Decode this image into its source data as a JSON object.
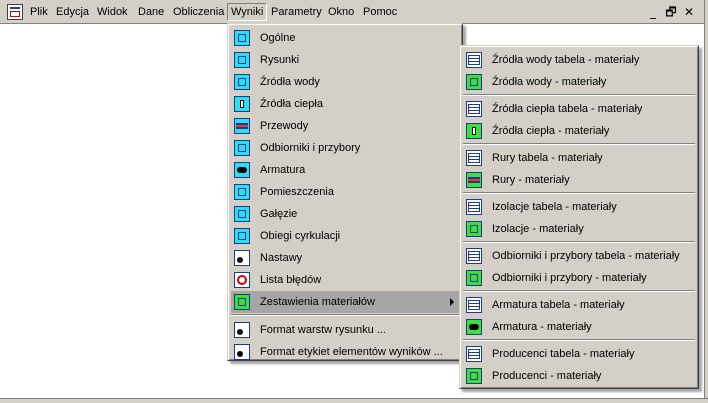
{
  "menubar": {
    "items": [
      "Plik",
      "Edycja",
      "Widok",
      "Dane",
      "Obliczenia",
      "Wyniki",
      "Parametry",
      "Okno",
      "Pomoc"
    ],
    "active": "Wyniki",
    "controls": [
      "_",
      "🗗",
      "✕"
    ]
  },
  "wyniki_menu": {
    "items": [
      {
        "label": "Ogólne",
        "icon": "house-icon"
      },
      {
        "label": "Rysunki",
        "icon": "drawing-icon"
      },
      {
        "label": "Źródła wody",
        "icon": "water-source-icon"
      },
      {
        "label": "Źródła ciepła",
        "icon": "heat-source-icon"
      },
      {
        "label": "Przewody",
        "icon": "pipes-icon"
      },
      {
        "label": "Odbiorniki i przybory",
        "icon": "receivers-icon"
      },
      {
        "label": "Armatura",
        "icon": "fittings-icon"
      },
      {
        "label": "Pomieszczenia",
        "icon": "rooms-icon"
      },
      {
        "label": "Gałęzie",
        "icon": "branches-icon"
      },
      {
        "label": "Obiegi cyrkulacji",
        "icon": "circulation-icon"
      },
      {
        "label": "Nastawy",
        "icon": "settings-icon"
      },
      {
        "label": "Lista błędów",
        "icon": "error-list-icon"
      },
      {
        "label": "Zestawienia materiałów",
        "icon": "materials-icon"
      },
      {
        "label": "Format warstw rysunku ...",
        "icon": "layers-format-icon"
      },
      {
        "label": "Format etykiet elementów wyników ...",
        "icon": "labels-format-icon"
      }
    ],
    "highlighted": "Zestawienia materiałów"
  },
  "materials_submenu": {
    "items": [
      {
        "label": "Źródła wody tabela - materiały",
        "icon": "water-source-table-icon"
      },
      {
        "label": "Źródła wody - materiały",
        "icon": "water-source-icon"
      },
      {
        "label": "Źródła ciepła tabela - materiały",
        "icon": "heat-source-table-icon"
      },
      {
        "label": "Źródła ciepła - materiały",
        "icon": "heat-source-icon"
      },
      {
        "label": "Rury tabela - materiały",
        "icon": "pipes-table-icon"
      },
      {
        "label": "Rury - materiały",
        "icon": "pipes-icon"
      },
      {
        "label": "Izolacje tabela - materiały",
        "icon": "insulation-table-icon"
      },
      {
        "label": "Izolacje - materiały",
        "icon": "insulation-icon"
      },
      {
        "label": "Odbiorniki i przybory tabela - materiały",
        "icon": "receivers-table-icon"
      },
      {
        "label": "Odbiorniki i przybory - materiały",
        "icon": "receivers-icon"
      },
      {
        "label": "Armatura tabela - materiały",
        "icon": "fittings-table-icon"
      },
      {
        "label": "Armatura - materiały",
        "icon": "fittings-icon"
      },
      {
        "label": "Producenci tabela - materiały",
        "icon": "producers-table-icon"
      },
      {
        "label": "Producenci - materiały",
        "icon": "producers-icon"
      }
    ]
  },
  "colors": {
    "menu_bg": "#d4d0c8",
    "highlight": "#a6a6a6",
    "icon_cyan": "#29e0f0",
    "icon_green": "#3ce03c",
    "icon_navy": "#1e3a8a"
  }
}
